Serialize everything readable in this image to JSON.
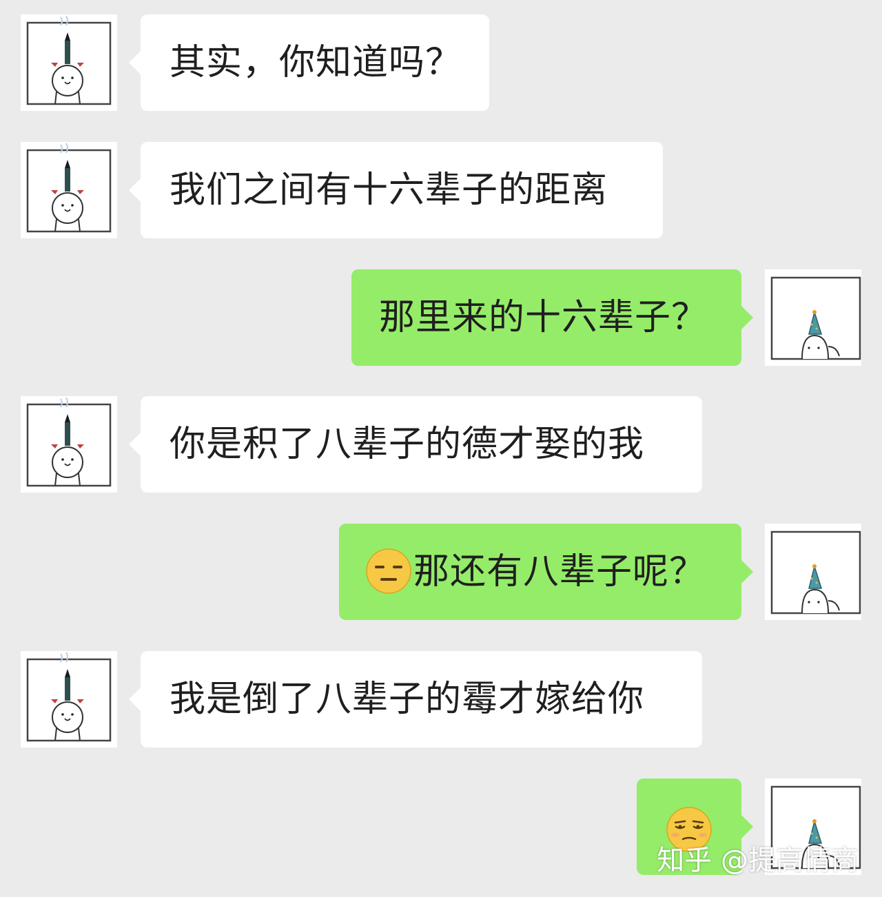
{
  "chat": {
    "messages": [
      {
        "side": "left",
        "text": "其实，你知道吗？"
      },
      {
        "side": "left",
        "text": "我们之间有十六辈子的距离"
      },
      {
        "side": "right",
        "text": "那里来的十六辈子？"
      },
      {
        "side": "left",
        "text": "你是积了八辈子的德才娶的我"
      },
      {
        "side": "right",
        "emoji": "expressionless-face-icon",
        "text": "那还有八辈子呢？"
      },
      {
        "side": "left",
        "text": "我是倒了八辈子的霉才嫁给你"
      },
      {
        "side": "right",
        "emoji": "unamused-face-icon",
        "text": ""
      }
    ]
  },
  "watermark": "知乎 @提高情商",
  "colors": {
    "background": "#ebebeb",
    "incoming_bubble": "#ffffff",
    "outgoing_bubble": "#95ec69",
    "text": "#1f1f1f"
  }
}
